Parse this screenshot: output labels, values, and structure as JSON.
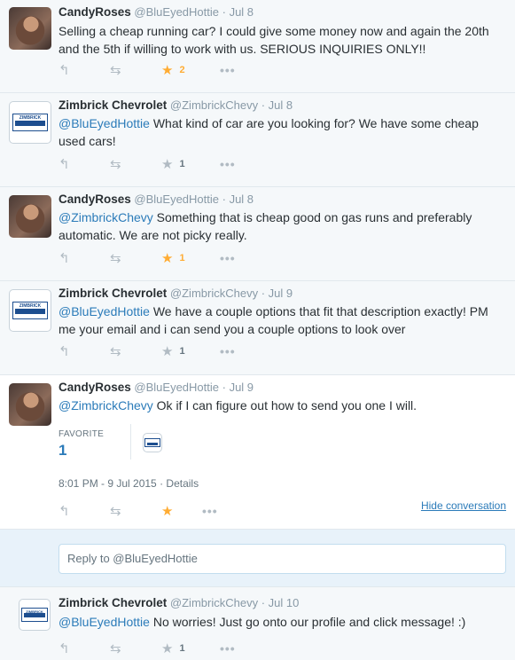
{
  "tweets": [
    {
      "name": "CandyRoses",
      "handle": "@BluEyedHottie",
      "dot": "·",
      "time": "Jul 8",
      "mention": "",
      "text": "Selling a cheap running car? I could give some money now and again the 20th and the 5th if willing to work with us. SERIOUS INQUIRIES ONLY!!",
      "favorites": "2"
    },
    {
      "name": "Zimbrick Chevrolet",
      "handle": "@ZimbrickChevy",
      "dot": "·",
      "time": "Jul 8",
      "mention": "@BluEyedHottie",
      "text": " What kind of car are you looking for? We have some cheap used cars!",
      "favorites": "1"
    },
    {
      "name": "CandyRoses",
      "handle": "@BluEyedHottie",
      "dot": "·",
      "time": "Jul 8",
      "mention": "@ZimbrickChevy",
      "text": " Something that is cheap good on gas runs and preferably automatic. We are not picky really.",
      "favorites": "1"
    },
    {
      "name": "Zimbrick Chevrolet",
      "handle": "@ZimbrickChevy",
      "dot": "·",
      "time": "Jul 9",
      "mention": "@BluEyedHottie",
      "text": " We have a couple options that fit that description exactly! PM me your email and i can send you a couple options to look over",
      "favorites": "1"
    },
    {
      "name": "CandyRoses",
      "handle": "@BluEyedHottie",
      "dot": "·",
      "time": "Jul 9",
      "mention": "@ZimbrickChevy",
      "text": " Ok if I can figure out how to send you one I will.",
      "favorites": ""
    },
    {
      "name": "Zimbrick Chevrolet",
      "handle": "@ZimbrickChevy",
      "dot": "·",
      "time": "Jul 10",
      "mention": "@BluEyedHottie",
      "text": " No worries! Just go onto our profile and click message! :)",
      "favorites": "1"
    }
  ],
  "logo_text": "ZIMBRICK",
  "expanded": {
    "favorite_label": "FAVORITE",
    "favorite_count": "1",
    "timestamp": "8:01 PM - 9 Jul 2015",
    "dot": "·",
    "details_link": "Details",
    "hide_conversation": "Hide conversation"
  },
  "reply_box": {
    "placeholder": "Reply to @BluEyedHottie"
  },
  "icons": {
    "reply": "reply-arrow-icon",
    "retweet": "retweet-icon",
    "favorite": "star-icon",
    "more": "more-dots-icon"
  },
  "colors": {
    "link": "#2b7bb9",
    "favorite_active": "#ffac33",
    "muted": "#8899a6"
  }
}
